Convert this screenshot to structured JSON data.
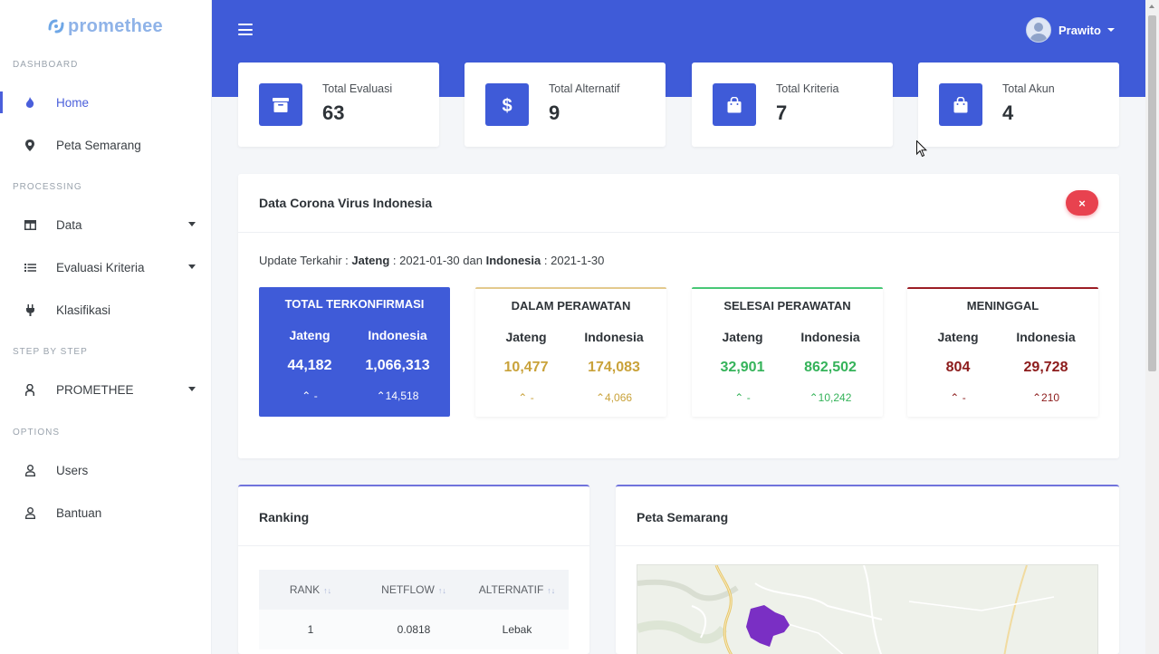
{
  "brand": {
    "name": "promethee",
    "accent": "#3f5bd8"
  },
  "sidebar": {
    "headings": {
      "dashboard": "DASHBOARD",
      "processing": "PROCESSING",
      "step_by_step": "STEP BY STEP",
      "options": "OPTIONS"
    },
    "items": [
      {
        "label": "Home",
        "icon": "fire-icon",
        "active": true
      },
      {
        "label": "Peta Semarang",
        "icon": "map-marker-icon"
      },
      {
        "label": "Data",
        "icon": "table-icon",
        "has_caret": true
      },
      {
        "label": "Evaluasi Kriteria",
        "icon": "list-icon",
        "has_caret": true
      },
      {
        "label": "Klasifikasi",
        "icon": "plug-icon"
      },
      {
        "label": "PROMETHEE",
        "icon": "user-tie-icon",
        "has_caret": true
      },
      {
        "label": "Users",
        "icon": "user-icon"
      },
      {
        "label": "Bantuan",
        "icon": "user-icon"
      }
    ]
  },
  "header": {
    "user_name": "Prawito"
  },
  "stats": [
    {
      "label": "Total Evaluasi",
      "value": "63",
      "icon": "archive-icon"
    },
    {
      "label": "Total Alternatif",
      "value": "9",
      "icon": "dollar-icon"
    },
    {
      "label": "Total Kriteria",
      "value": "7",
      "icon": "shopping-bag-icon"
    },
    {
      "label": "Total Akun",
      "value": "4",
      "icon": "shopping-bag-icon"
    }
  ],
  "corona": {
    "title": "Data Corona Virus Indonesia",
    "close_label": "×",
    "update_prefix": "Update Terkahir :",
    "update_region1": "Jateng",
    "update_date1": ": 2021-01-30 dan",
    "update_region2": "Indonesia",
    "update_date2": ": 2021-1-30",
    "cards": [
      {
        "title": "TOTAL TERKONFIRMASI",
        "jateng_label": "Jateng",
        "indonesia_label": "Indonesia",
        "jateng_value": "44,182",
        "indonesia_value": "1,066,313",
        "jateng_delta": "-",
        "indonesia_delta": "14,518"
      },
      {
        "title": "DALAM PERAWATAN",
        "jateng_label": "Jateng",
        "indonesia_label": "Indonesia",
        "jateng_value": "10,477",
        "indonesia_value": "174,083",
        "jateng_delta": "-",
        "indonesia_delta": "4,066"
      },
      {
        "title": "SELESAI PERAWATAN",
        "jateng_label": "Jateng",
        "indonesia_label": "Indonesia",
        "jateng_value": "32,901",
        "indonesia_value": "862,502",
        "jateng_delta": "-",
        "indonesia_delta": "10,242"
      },
      {
        "title": "MENINGGAL",
        "jateng_label": "Jateng",
        "indonesia_label": "Indonesia",
        "jateng_value": "804",
        "indonesia_value": "29,728",
        "jateng_delta": "-",
        "indonesia_delta": "210"
      }
    ]
  },
  "ranking": {
    "title": "Ranking",
    "columns": [
      "RANK",
      "NETFLOW",
      "ALTERNATIF"
    ],
    "rows": [
      {
        "rank": "1",
        "netflow": "0.0818",
        "alternatif": "Lebak"
      }
    ]
  },
  "map": {
    "title": "Peta Semarang",
    "region_color": "#7a2fc4"
  }
}
